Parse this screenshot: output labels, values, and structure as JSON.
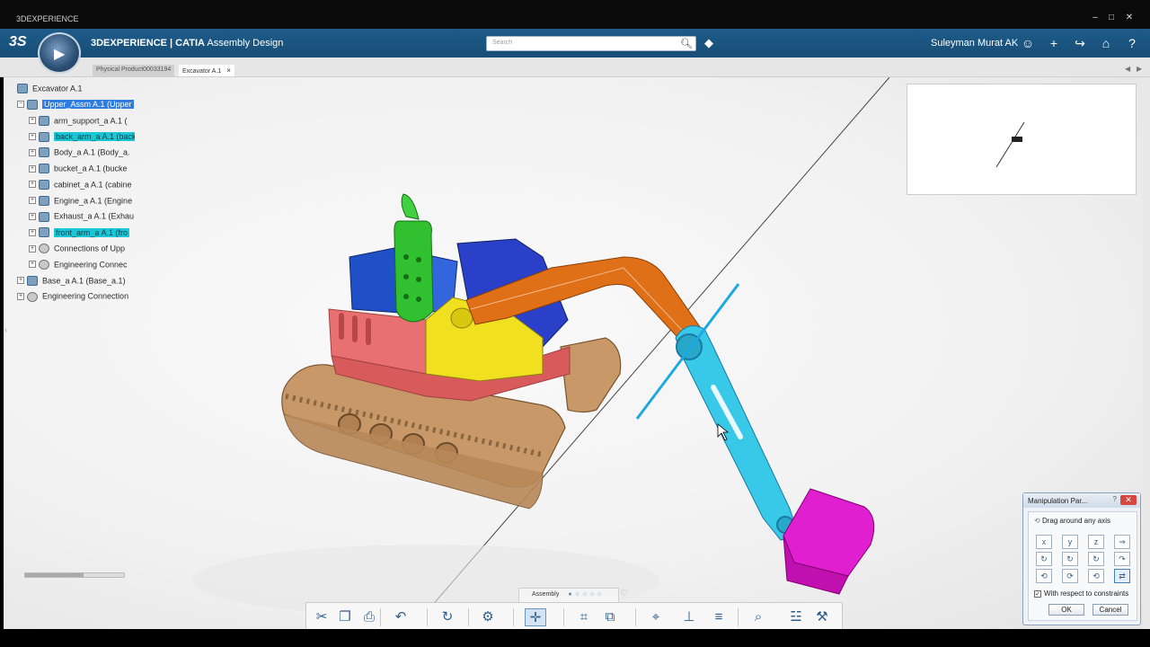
{
  "os": {
    "title": "3DEXPERIENCE",
    "win_buttons": [
      "‒",
      "□",
      "✕"
    ]
  },
  "header": {
    "brand": "3DEXPERIENCE | CATIA",
    "app": "Assembly Design",
    "search_placeholder": "Search",
    "user": "Suleyman Murat AK",
    "icons": [
      "search-icon",
      "tag-icon",
      "user-icon",
      "plus-icon",
      "share-icon",
      "home-icon",
      "help-icon"
    ]
  },
  "tabs": [
    {
      "label": "Physical Product00033194",
      "active": false
    },
    {
      "label": "Excavator A.1",
      "active": true,
      "close": "×"
    }
  ],
  "tree": {
    "items": [
      {
        "label": "Excavator A.1",
        "level": 0,
        "selection": ""
      },
      {
        "label": "Upper_Assm A.1 (Upper",
        "level": 0,
        "selection": "blue",
        "expanded": true
      },
      {
        "label": "arm_support_a A.1 (",
        "level": 1,
        "selection": ""
      },
      {
        "label": "back_arm_a A.1 (back",
        "level": 1,
        "selection": "cyan"
      },
      {
        "label": "Body_a A.1 (Body_a.",
        "level": 1,
        "selection": ""
      },
      {
        "label": "bucket_a A.1 (bucke",
        "level": 1,
        "selection": ""
      },
      {
        "label": "cabinet_a A.1 (cabine",
        "level": 1,
        "selection": ""
      },
      {
        "label": "Engine_a A.1 (Engine",
        "level": 1,
        "selection": ""
      },
      {
        "label": "Exhaust_a A.1 (Exhau",
        "level": 1,
        "selection": ""
      },
      {
        "label": "front_arm_a A.1 (fro",
        "level": 1,
        "selection": "cyan"
      },
      {
        "label": "Connections of Upp",
        "level": 1,
        "selection": "",
        "kind": "conn"
      },
      {
        "label": "Engineering Connec",
        "level": 1,
        "selection": "",
        "kind": "conn"
      },
      {
        "label": "Base_a A.1 (Base_a.1)",
        "level": 0,
        "selection": ""
      },
      {
        "label": "Engineering Connection",
        "level": 0,
        "selection": "",
        "kind": "conn"
      }
    ]
  },
  "manipulation": {
    "title": "Manipulation Par...",
    "help": "?",
    "close": "✕",
    "drag_label": "Drag around any axis",
    "constraints_label": "With respect to constraints",
    "constraints_checked": true,
    "ok": "OK",
    "cancel": "Cancel",
    "buttons": [
      "x",
      "y",
      "z",
      "⇒",
      "↻",
      "↻",
      "↻",
      "↷",
      "⟲",
      "⟳",
      "⟲",
      "⇄"
    ]
  },
  "bottom": {
    "section": "Assembly",
    "dots": "● ○ ○ ○ ○",
    "toolbar_icons": [
      "cut-icon",
      "copy-icon",
      "paste-icon",
      "undo-icon",
      "update-icon",
      "product-icon",
      "manipulate-icon",
      "snap-icon",
      "explode-icon",
      "measure-icon",
      "axis-icon",
      "align-icon",
      "zoom-icon",
      "engineering-connection-icon",
      "tools-icon"
    ]
  },
  "colors": {
    "header": "#1e5c8a",
    "tree_selected_blue": "#2f7de0",
    "tree_selected_cyan": "#19c7d6",
    "arm_orange": "#e07018",
    "arm_cyan": "#38c8e8",
    "bucket_magenta": "#e020d0",
    "engine_blue": "#2050c8",
    "body_red": "#e87070",
    "exhaust_green": "#30c030",
    "cabin_yellow": "#f0e020",
    "track_tan": "#c89868"
  }
}
